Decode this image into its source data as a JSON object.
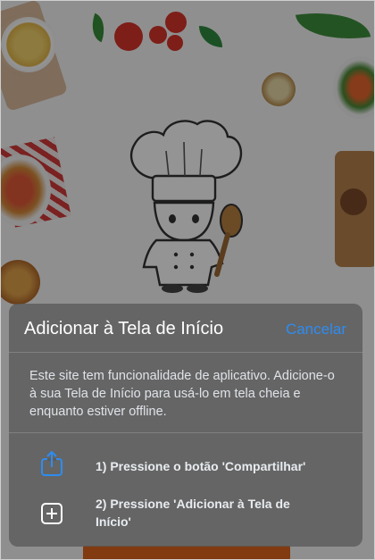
{
  "sheet": {
    "title": "Adicionar à Tela de Início",
    "cancel_label": "Cancelar",
    "description": "Este site tem funcionalidade de aplicativo. Adicione-o à sua Tela de Início para usá-lo em tela cheia e enquanto estiver offline.",
    "steps": [
      {
        "icon": "share-icon",
        "text": "1) Pressione o botão 'Compartilhar'"
      },
      {
        "icon": "add-square-icon",
        "text": "2) Pressione 'Adicionar à Tela de Início'"
      }
    ]
  },
  "colors": {
    "accent": "#2e8cf0",
    "overlay": "#5c5c5c",
    "bottom_bar": "#e0641e"
  }
}
